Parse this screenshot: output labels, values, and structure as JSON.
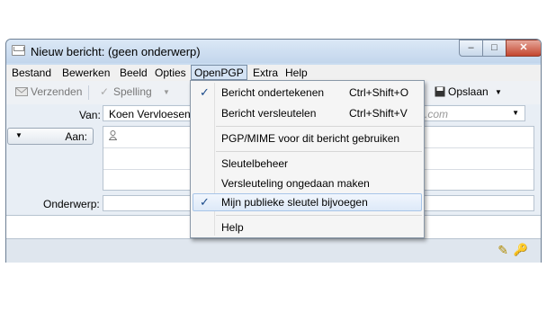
{
  "window": {
    "title": "Nieuw bericht: (geen onderwerp)",
    "controls": {
      "minimize": "–",
      "maximize": "□",
      "close": "✕"
    }
  },
  "menubar": {
    "items": [
      {
        "label": "Bestand"
      },
      {
        "label": "Bewerken"
      },
      {
        "label": "Beeld"
      },
      {
        "label": "Opties"
      },
      {
        "label": "OpenPGP",
        "active": true
      },
      {
        "label": "Extra"
      },
      {
        "label": "Help"
      }
    ]
  },
  "toolbar": {
    "send": "Verzenden",
    "spelling": "Spelling",
    "save": "Opslaan"
  },
  "header": {
    "from_label": "Van:",
    "from_value": "Koen Vervloesen",
    "from_suffix": ".com",
    "to_label": "Aan:",
    "subject_label": "Onderwerp:",
    "subject_value": ""
  },
  "openpgp_menu": {
    "items": [
      {
        "label": "Bericht ondertekenen",
        "shortcut": "Ctrl+Shift+O",
        "checked": true
      },
      {
        "label": "Bericht versleutelen",
        "shortcut": "Ctrl+Shift+V",
        "checked": false
      },
      {
        "label": "PGP/MIME voor dit bericht gebruiken",
        "shortcut": "",
        "checked": false
      },
      {
        "label": "Sleutelbeheer",
        "shortcut": "",
        "checked": false
      },
      {
        "label": "Versleuteling ongedaan maken",
        "shortcut": "",
        "checked": false
      },
      {
        "label": "Mijn publieke sleutel bijvoegen",
        "shortcut": "",
        "checked": true,
        "highlighted": true
      },
      {
        "label": "Help",
        "shortcut": "",
        "checked": false
      }
    ]
  },
  "icons": {
    "check": "✓",
    "dropdown": "▼",
    "pencil": "✎",
    "key": "🔑"
  },
  "colors": {
    "frame": "#c9dcf0",
    "menu_highlight": "#dde9f8",
    "close_button": "#c4462f"
  }
}
